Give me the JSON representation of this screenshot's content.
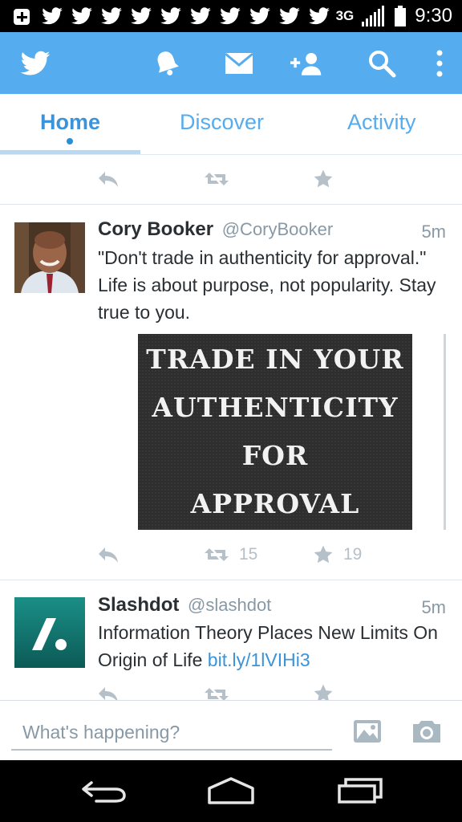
{
  "status_bar": {
    "notification_icons": [
      "add-box-icon",
      "twitter-bird-icon",
      "twitter-bird-icon",
      "twitter-bird-icon",
      "twitter-bird-icon",
      "twitter-bird-icon",
      "twitter-bird-icon",
      "twitter-bird-icon",
      "twitter-bird-icon",
      "twitter-bird-icon"
    ],
    "network": "3G",
    "time": "9:30"
  },
  "action_bar": {
    "color": "#55acee",
    "icons": [
      "twitter-logo-icon",
      "bell-icon",
      "envelope-icon",
      "add-user-icon",
      "search-icon",
      "overflow-menu-icon"
    ]
  },
  "tabs": [
    {
      "label": "Home",
      "active": true
    },
    {
      "label": "Discover",
      "active": false
    },
    {
      "label": "Activity",
      "active": false
    }
  ],
  "tweets": [
    {
      "name": "Cory Booker",
      "handle": "@CoryBooker",
      "time": "5m",
      "text": "\"Don't trade in authenticity for approval.\" Life is about purpose, not popularity. Stay true to you.",
      "media_lines": [
        "TRADE IN YOUR",
        "AUTHENTICITY",
        "FOR",
        "APPROVAL"
      ],
      "retweets": "15",
      "favorites": "19"
    },
    {
      "name": "Slashdot",
      "handle": "@slashdot",
      "time": "5m",
      "text": "Information Theory Places New Limits On Origin of Life ",
      "link": "bit.ly/1lVIHi3"
    }
  ],
  "compose": {
    "placeholder": "What's happening?"
  },
  "nav_bar": {
    "icons": [
      "back-icon",
      "home-icon",
      "recents-icon"
    ]
  }
}
